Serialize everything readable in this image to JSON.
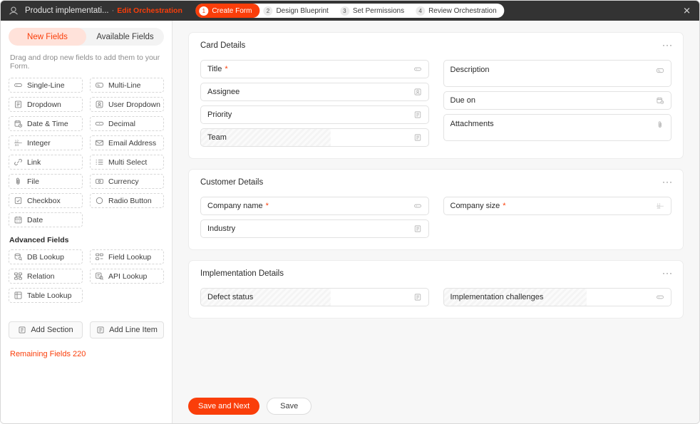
{
  "titlebar": {
    "logo_icon": "app-logo-icon",
    "title": "Product implementati...",
    "separator": "·",
    "edit_link": "Edit Orchestration",
    "close_icon": "close-icon",
    "steps": [
      {
        "num": "1",
        "label": "Create Form",
        "active": true
      },
      {
        "num": "2",
        "label": "Design Blueprint",
        "active": false
      },
      {
        "num": "3",
        "label": "Set Permissions",
        "active": false
      },
      {
        "num": "4",
        "label": "Review Orchestration",
        "active": false
      }
    ]
  },
  "sidebar": {
    "tabs": [
      {
        "label": "New Fields",
        "active": true
      },
      {
        "label": "Available Fields",
        "active": false
      }
    ],
    "hint": "Drag and drop new fields to add them to your Form.",
    "basic_fields": [
      {
        "label": "Single-Line",
        "icon": "single-line-icon"
      },
      {
        "label": "Multi-Line",
        "icon": "multi-line-icon"
      },
      {
        "label": "Dropdown",
        "icon": "dropdown-icon"
      },
      {
        "label": "User Dropdown",
        "icon": "user-dropdown-icon"
      },
      {
        "label": "Date & Time",
        "icon": "date-time-icon"
      },
      {
        "label": "Decimal",
        "icon": "decimal-icon"
      },
      {
        "label": "Integer",
        "icon": "integer-icon"
      },
      {
        "label": "Email Address",
        "icon": "email-icon"
      },
      {
        "label": "Link",
        "icon": "link-icon"
      },
      {
        "label": "Multi Select",
        "icon": "multi-select-icon"
      },
      {
        "label": "File",
        "icon": "file-icon"
      },
      {
        "label": "Currency",
        "icon": "currency-icon"
      },
      {
        "label": "Checkbox",
        "icon": "checkbox-icon"
      },
      {
        "label": "Radio Button",
        "icon": "radio-button-icon"
      },
      {
        "label": "Date",
        "icon": "date-icon"
      }
    ],
    "advanced_heading": "Advanced Fields",
    "advanced_fields": [
      {
        "label": "DB Lookup",
        "icon": "db-lookup-icon"
      },
      {
        "label": "Field Lookup",
        "icon": "field-lookup-icon"
      },
      {
        "label": "Relation",
        "icon": "relation-icon"
      },
      {
        "label": "API Lookup",
        "icon": "api-lookup-icon"
      },
      {
        "label": "Table Lookup",
        "icon": "table-lookup-icon"
      }
    ],
    "add_buttons": [
      {
        "label": "Add Section",
        "icon": "add-section-icon"
      },
      {
        "label": "Add Line Item",
        "icon": "add-line-item-icon"
      }
    ],
    "remaining_fields": "Remaining Fields 220"
  },
  "canvas": {
    "menu_dots": "···",
    "sections": [
      {
        "title": "Card Details",
        "left": [
          {
            "label": "Title",
            "required": true,
            "icon": "single-line-icon",
            "tall": false,
            "shaded": false
          },
          {
            "label": "Assignee",
            "required": false,
            "icon": "user-dropdown-icon",
            "tall": false,
            "shaded": false
          },
          {
            "label": "Priority",
            "required": false,
            "icon": "dropdown-icon",
            "tall": false,
            "shaded": false
          },
          {
            "label": "Team",
            "required": false,
            "icon": "dropdown-icon",
            "tall": false,
            "shaded": true
          }
        ],
        "right": [
          {
            "label": "Description",
            "required": false,
            "icon": "multi-line-icon",
            "tall": true,
            "shaded": false
          },
          {
            "label": "Due on",
            "required": false,
            "icon": "date-time-icon",
            "tall": false,
            "shaded": false
          },
          {
            "label": "Attachments",
            "required": false,
            "icon": "file-icon",
            "tall": true,
            "shaded": false
          }
        ]
      },
      {
        "title": "Customer Details",
        "left": [
          {
            "label": "Company name",
            "required": true,
            "icon": "single-line-icon",
            "tall": false,
            "shaded": false
          },
          {
            "label": "Industry",
            "required": false,
            "icon": "dropdown-icon",
            "tall": false,
            "shaded": false
          }
        ],
        "right": [
          {
            "label": "Company size",
            "required": true,
            "icon": "integer-icon",
            "tall": false,
            "shaded": false
          }
        ]
      },
      {
        "title": "Implementation Details",
        "left": [
          {
            "label": "Defect status",
            "required": false,
            "icon": "dropdown-icon",
            "tall": false,
            "shaded": true
          }
        ],
        "right": [
          {
            "label": "Implementation challenges",
            "required": false,
            "icon": "single-line-icon",
            "tall": false,
            "shaded": true
          }
        ]
      }
    ],
    "footer": {
      "primary": "Save and Next",
      "secondary": "Save"
    }
  },
  "colors": {
    "accent": "#fa3e0a",
    "accent_soft": "#ffe2da",
    "titlebar": "#333333",
    "canvas_bg": "#f7f7f7"
  }
}
